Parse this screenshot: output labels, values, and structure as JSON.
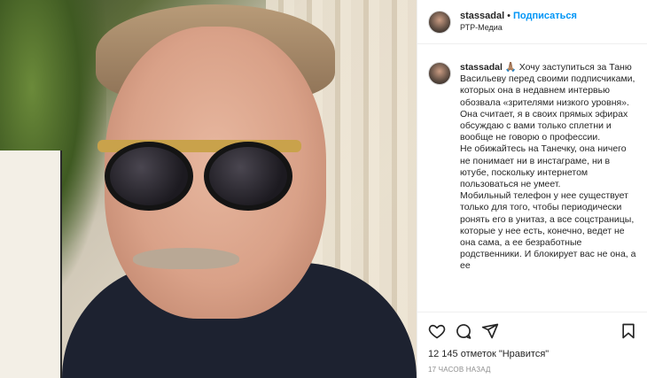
{
  "post": {
    "username": "stassadal",
    "separator": "•",
    "follow_label": "Подписаться",
    "location": "РТР-Медиа"
  },
  "caption": {
    "username": "stassadal",
    "emoji": "🙏🏽",
    "lines": [
      "Хочу заступиться за Таню Васильеву перед своими подписчиками, которых она в недавнем интервью обозвала «зрителями низкого уровня».",
      "Она считает, я в своих прямых эфирах обсуждаю с вами только сплетни и вообще не говорю о профессии.",
      "Не обижайтесь на Танечку, она ничего не понимает ни в инстаграме, ни в ютубе, поскольку интернетом пользоваться не умеет.",
      "Мобильный телефон у нее существует только для того, чтобы периодически ронять его в унитаз, а все соцстраницы, которые у нее есть, конечно, ведет не она сама, а ее безработные родственники. И блокирует вас не она, а ее"
    ]
  },
  "actions": {
    "likes_text": "12 145 отметок \"Нравится\"",
    "time_text": "17 часов назад"
  },
  "icons": [
    "heart-icon",
    "comment-icon",
    "share-icon",
    "bookmark-icon"
  ]
}
